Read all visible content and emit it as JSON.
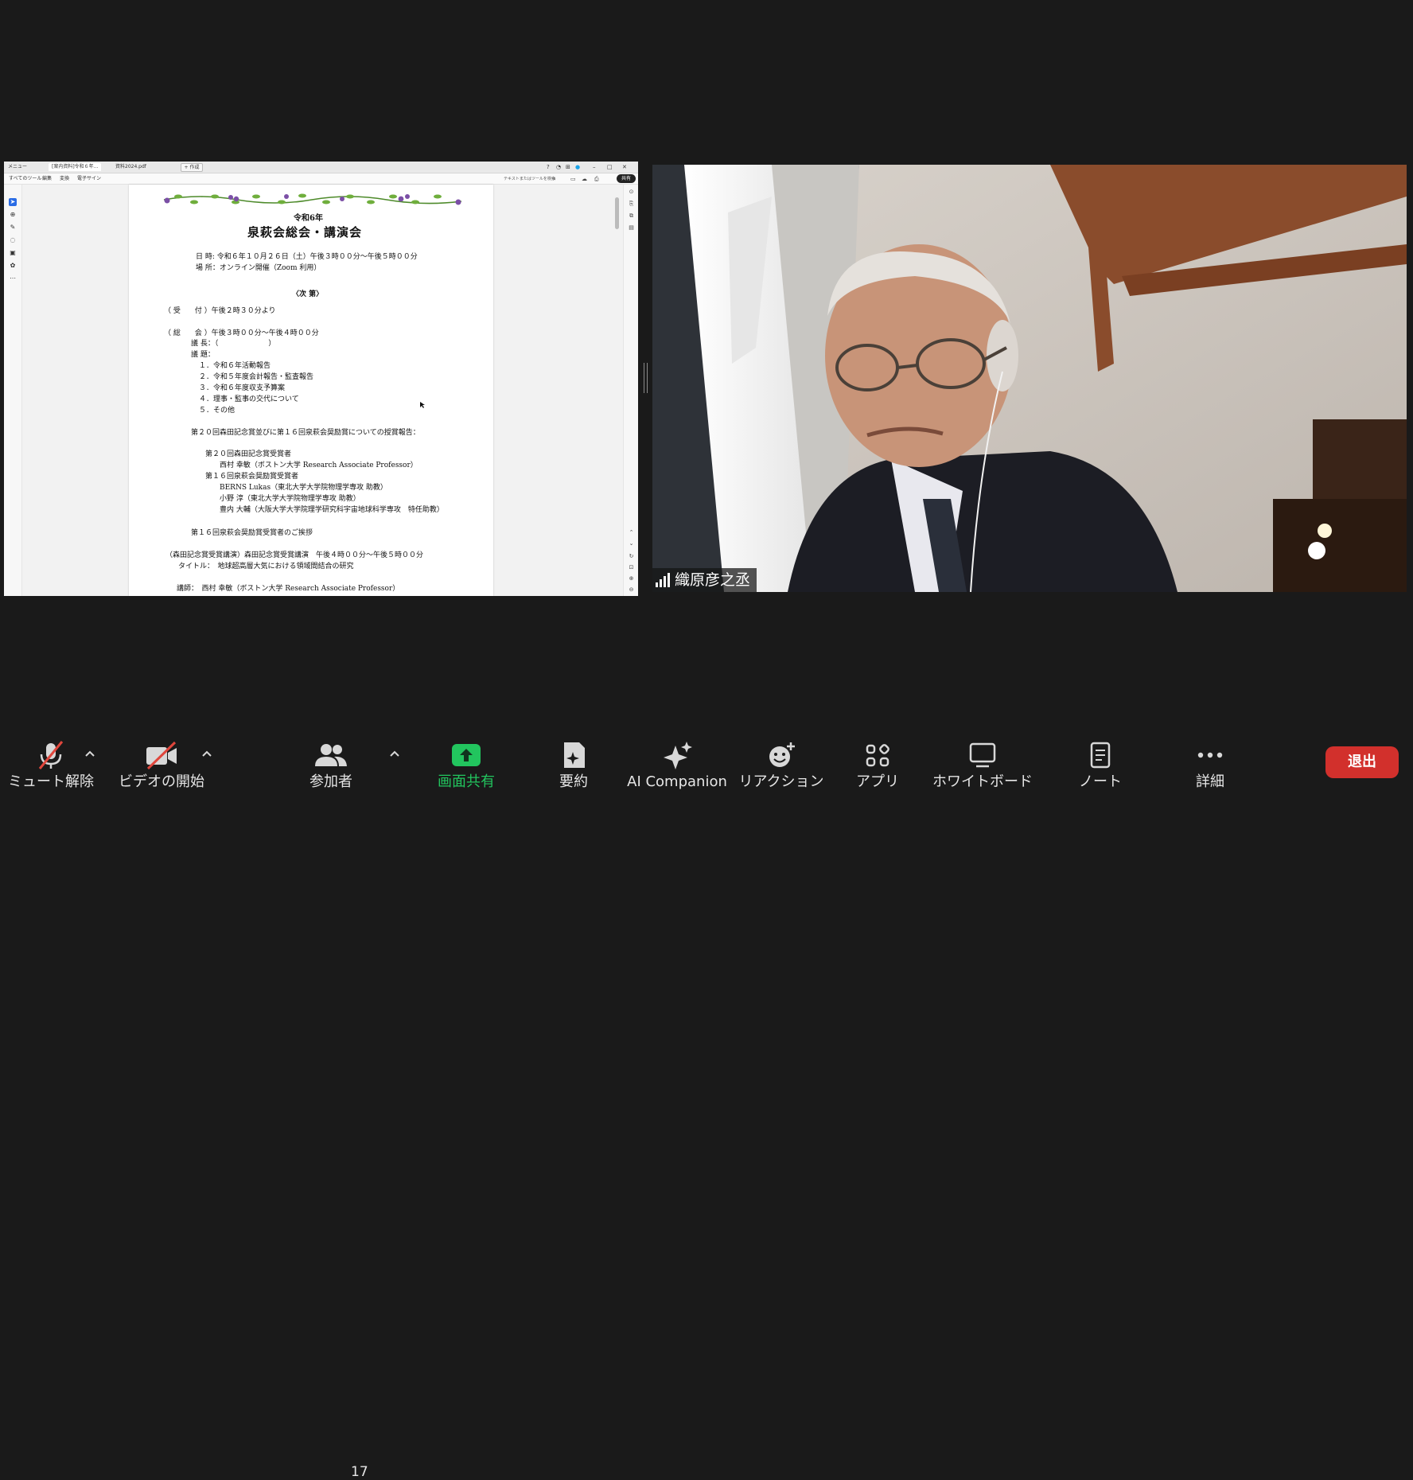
{
  "shared_screen": {
    "tabs": [
      {
        "label": "メニュー"
      },
      {
        "label": "[案内資料]令和６年..."
      },
      {
        "label": "資料2024.pdf"
      }
    ],
    "new_tab_label": "+ 作成",
    "toolbar_items": [
      "すべてのツール",
      "編集",
      "変換",
      "電子サイン"
    ],
    "search_placeholder": "テキストまたはツールを検索",
    "share_button": "共有",
    "document": {
      "year": "令和6年",
      "title": "泉萩会総会・講演会",
      "date_line": "日 時: 令和６年１０月２６日（土）午後３時００分〜午後５時００分",
      "place_line": "場 所：オンライン開催（Zoom 利用）",
      "program_heading": "〈次 第〉",
      "reception": "（ 受　　付 ）午後２時３０分より",
      "general_meeting": "（ 総　　会 ）午後３時００分〜午後４時００分",
      "chair": "議 長：（　　　　　　　）",
      "agenda_heading": "議 題：",
      "agenda": [
        "１．令和６年活動報告",
        "２．令和５年度会計報告・監査報告",
        "３．令和６年度収支予算案",
        "４．理事・監事の交代について",
        "５．その他"
      ],
      "award_report": "第２０回森田記念賞並びに第１６回泉萩会奨励賞についての授賞報告：",
      "morita_heading": "第２０回森田記念賞受賞者",
      "morita_winner": "西村 幸敏（ボストン大学 Research Associate Professor）",
      "encourage_heading": "第１６回泉萩会奨励賞受賞者",
      "encourage_winners": [
        "BERNS Lukas（東北大学大学院物理学専攻 助教）",
        "小野 淳（東北大学大学院物理学専攻 助教）",
        "豊内 大輔（大阪大学大学院理学研究科宇宙地球科学専攻　特任助教）"
      ],
      "greeting": "第１６回泉萩会奨励賞受賞者のご挨拶",
      "lecture": "（森田記念賞受賞講演）森田記念賞受賞講演　午後４時００分〜午後５時００分",
      "lecture_title": "タイトル：　地球超高層大気における領域間結合の研究",
      "lecturer": "講師：　西村 幸敏（ボストン大学 Research Associate Professor）"
    }
  },
  "video": {
    "participant_name": "織原彦之丞"
  },
  "toolbar": {
    "unmute": "ミュート解除",
    "start_video": "ビデオの開始",
    "participants": "参加者",
    "participant_count": "17",
    "share_screen": "画面共有",
    "summary": "要約",
    "ai_companion": "AI Companion",
    "reactions": "リアクション",
    "apps": "アプリ",
    "whiteboard": "ホワイトボード",
    "notes": "ノート",
    "more": "詳細",
    "leave": "退出"
  },
  "colors": {
    "background": "#1a1a1a",
    "share_green": "#22c55e",
    "leave_red": "#d2302c",
    "muted_slash": "#e0463c"
  }
}
